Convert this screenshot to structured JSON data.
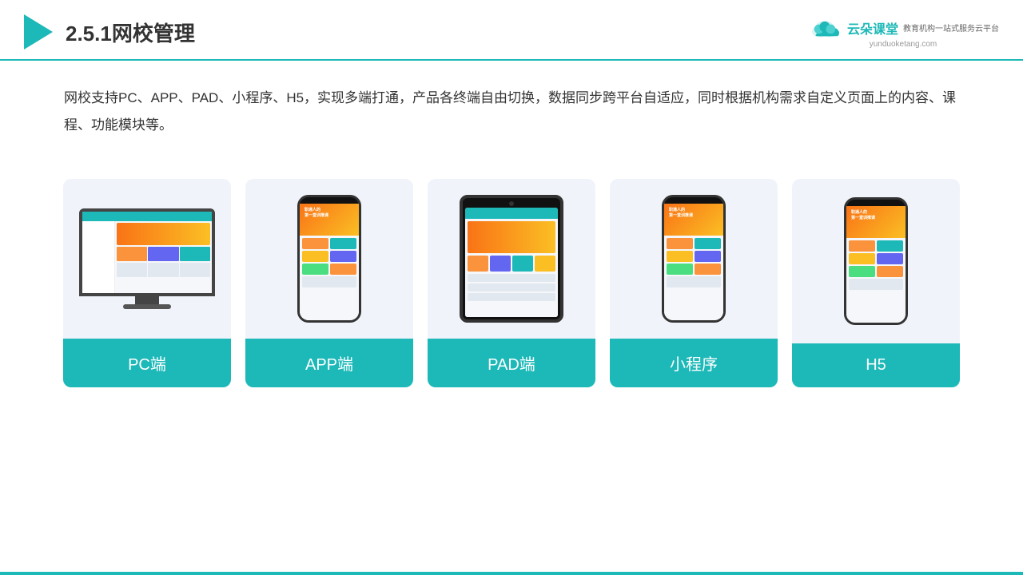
{
  "header": {
    "title": "2.5.1网校管理",
    "brand": {
      "name": "云朵课堂",
      "url": "yunduoketang.com",
      "tagline": "教育机构一站式服务云平台"
    }
  },
  "description": "网校支持PC、APP、PAD、小程序、H5，实现多端打通，产品各终端自由切换，数据同步跨平台自适应，同时根据机构需求自定义页面上的内容、课程、功能模块等。",
  "cards": [
    {
      "id": "pc",
      "label": "PC端"
    },
    {
      "id": "app",
      "label": "APP端"
    },
    {
      "id": "pad",
      "label": "PAD端"
    },
    {
      "id": "miniprogram",
      "label": "小程序"
    },
    {
      "id": "h5",
      "label": "H5"
    }
  ]
}
